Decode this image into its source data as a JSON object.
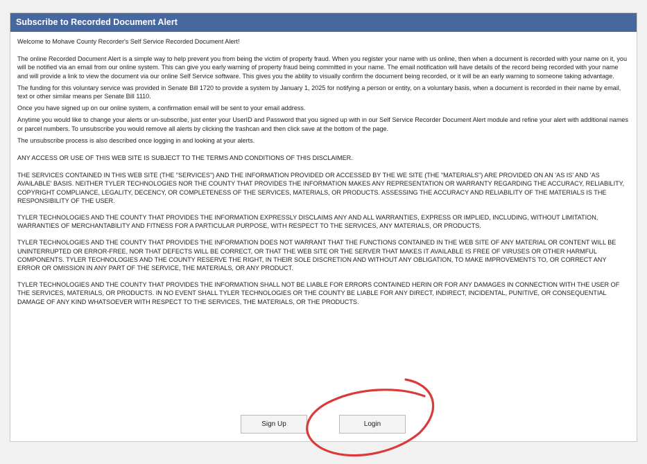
{
  "panel": {
    "title": "Subscribe to Recorded Document Alert"
  },
  "content": {
    "welcome": "Welcome to Mohave County Recorder's Self Service Recorded Document Alert!",
    "intro": "The online Recorded Document Alert is a simple way to help prevent you from being the victim of property fraud. When you register your name with us online, then when a document is recorded with your name on it, you will be notified via an email from our online system. This can give you early warning of property fraud being committed in your name. The email notification will have details of the record being recorded with your name and will provide a link to view the document via our online Self Service software. This gives you the ability to visually confirm the document being recorded, or it will be an early warning to someone taking advantage.",
    "funding": "The funding for this voluntary service was provided in Senate Bill 1720 to provide a system by January 1, 2025 for notifying a person or entity, on a voluntary basis, when a document is recorded in their name by email, text or other similar means per Senate Bill 1110.",
    "confirmation": "Once you have signed up on our online system, a confirmation email will be sent to your email address.",
    "change_alerts": "Anytime you would like to change your alerts or un-subscribe, just enter your UserID and Password that you signed up with in our Self Service Recorder Document Alert module and refine your alert with additional names or parcel numbers. To unsubscribe you would remove all alerts by clicking the trashcan and then click save at the bottom of the page.",
    "unsubscribe": "The unsubscribe process is also described once logging in and looking at your alerts.",
    "access": "ANY ACCESS OR USE OF THIS WEB SITE IS SUBJECT TO THE TERMS AND CONDITIONS OF THIS DISCLAIMER.",
    "services": "THE SERVICES CONTAINED IN THIS WEB SITE (THE \"SERVICES\") AND THE INFORMATION PROVIDED OR ACCESSED BY THE WE SITE (THE \"MATERIALS\") ARE PROVIDED ON AN 'AS IS' AND 'AS AVAILABLE' BASIS. NEITHER TYLER TECHNOLOGIES NOR THE COUNTY THAT PROVIDES THE INFORMATION MAKES ANY REPRESENTATION OR WARRANTY REGARDING THE ACCURACY, RELIABILITY, COPYRIGHT COMPLIANCE, LEGALITY, DECENCY, OR COMPLETENESS OF THE SERVICES, MATERIALS, OR PRODUCTS. ASSESSING THE ACCURACY AND RELIABILITY OF THE MATERIALS IS THE RESPONSIBILITY OF THE USER.",
    "warranties": "TYLER TECHNOLOGIES AND THE COUNTY THAT PROVIDES THE INFORMATION EXPRESSLY DISCLAIMS ANY AND ALL WARRANTIES, EXPRESS OR IMPLIED, INCLUDING, WITHOUT LIMITATION, WARRANTIES OF MERCHANTABILITY AND FITNESS FOR A PARTICULAR PURPOSE, WITH RESPECT TO THE SERVICES, ANY MATERIALS, OR PRODUCTS.",
    "functions": "TYLER TECHNOLOGIES AND THE COUNTY THAT PROVIDES THE INFORMATION DOES NOT WARRANT THAT THE FUNCTIONS CONTAINED IN THE WEB SITE OF ANY MATERIAL OR CONTENT WILL BE UNINTERRUPTED OR ERROR-FREE, NOR THAT DEFECTS WILL BE CORRECT, OR THAT THE WEB SITE OR THE SERVER THAT MAKES IT AVAILABLE IS FREE OF VIRUSES OR OTHER HARMFUL COMPONENTS. TYLER TECHNOLOGIES AND THE COUNTY RESERVE THE RIGHT, IN THEIR SOLE DISCRETION AND WITHOUT ANY OBLIGATION, TO MAKE IMPROVEMENTS TO, OR CORRECT ANY ERROR OR OMISSION IN ANY PART OF THE SERVICE, THE MATERIALS, OR ANY PRODUCT.",
    "liability": "TYLER TECHNOLOGIES AND THE COUNTY THAT PROVIDES THE INFORMATION SHALL NOT BE LIABLE FOR ERRORS CONTAINED HERIN OR FOR ANY DAMAGES IN CONNECTION WITH THE USER OF THE SERVICES, MATERIALS, OR PRODUCTS. IN NO EVENT SHALL TYLER TECHNOLOGIES OR THE COUNTY BE LIABLE FOR ANY DIRECT, INDIRECT, INCIDENTAL, PUNITIVE, OR CONSEQUENTIAL DAMAGE OF ANY KIND WHATSOEVER WITH RESPECT TO THE SERVICES, THE MATERIALS, OR THE PRODUCTS."
  },
  "buttons": {
    "signup_label": "Sign Up",
    "login_label": "Login"
  },
  "colors": {
    "header_bg": "#46689f",
    "annotation": "#d93a3a"
  }
}
